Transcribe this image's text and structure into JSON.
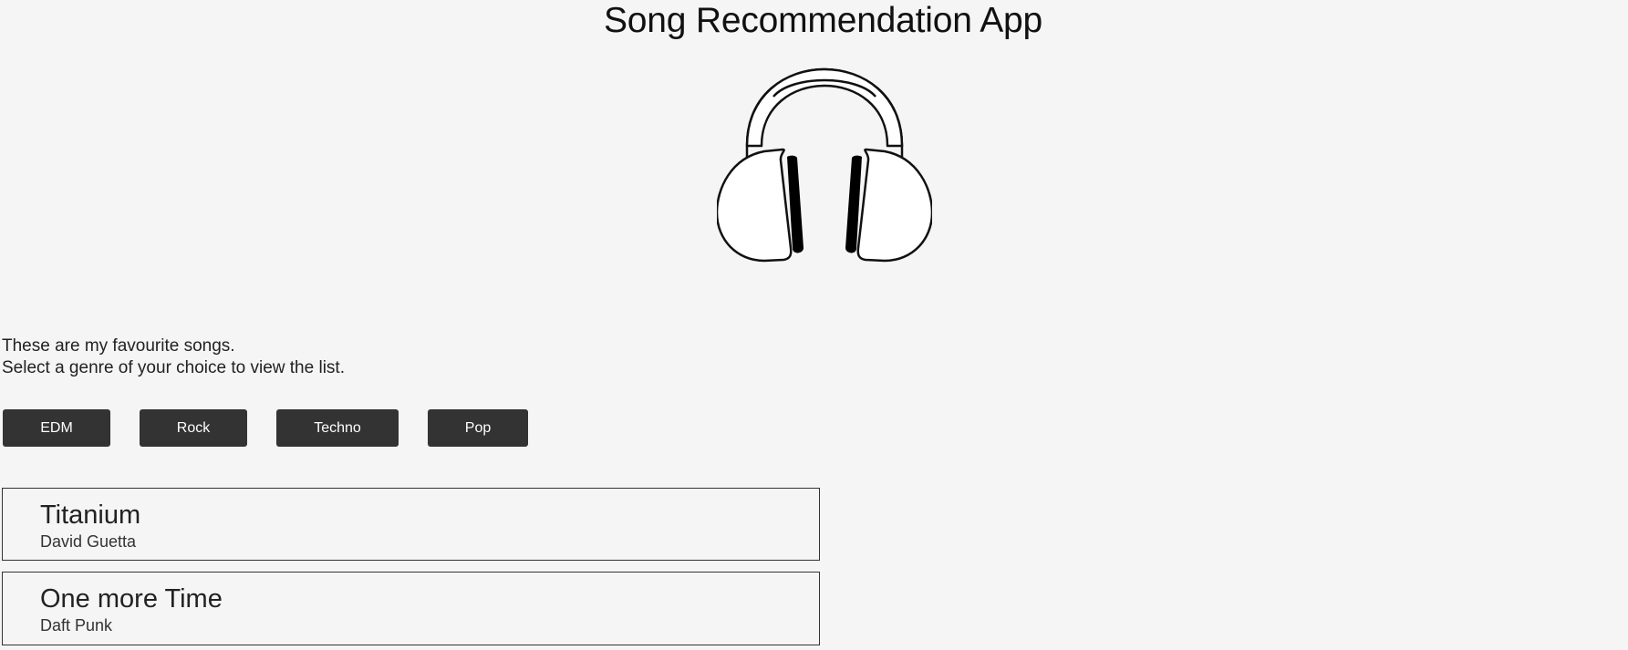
{
  "app": {
    "title": "Song Recommendation App",
    "logo_icon": "headphones-icon"
  },
  "intro": {
    "line1": "These are my favourite songs.",
    "line2": "Select a genre of your choice to view the list."
  },
  "genres": [
    {
      "label": "EDM"
    },
    {
      "label": "Rock"
    },
    {
      "label": "Techno"
    },
    {
      "label": "Pop"
    }
  ],
  "songs": [
    {
      "name": "Titanium",
      "artist": "David Guetta"
    },
    {
      "name": "One more Time",
      "artist": "Daft Punk"
    }
  ],
  "colors": {
    "background": "#f5f5f5",
    "button_bg": "#333333",
    "button_text": "#ffffff",
    "card_border": "#333333"
  }
}
